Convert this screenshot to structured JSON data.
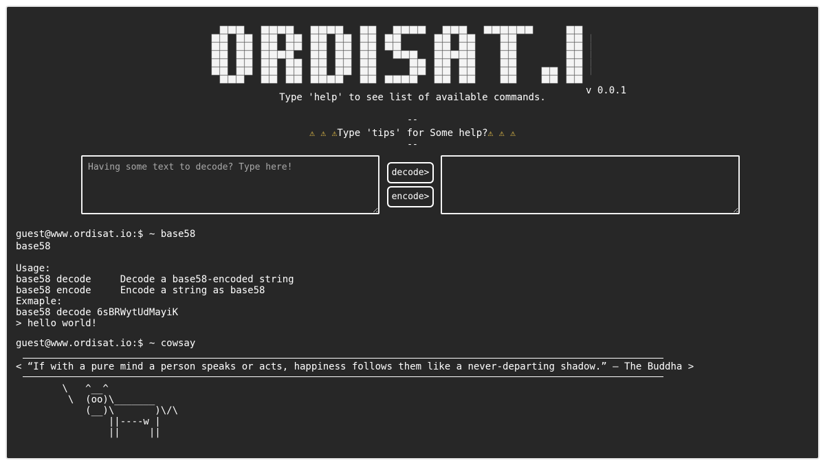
{
  "header": {
    "logo_text": "ORDISAT.IO",
    "version": "v 0.0.1",
    "help_text": "Type 'help' to see list of available commands.",
    "separator": "--",
    "tips_text": "Type 'tips' for Some help?",
    "warning_icon": "⚠"
  },
  "converter": {
    "input_placeholder": "Having some text to decode? Type here!",
    "input_value": "",
    "output_value": "",
    "decode_label": "decode>",
    "encode_label": "encode>"
  },
  "terminal": {
    "prompt1": "guest@www.ordisat.io:$ ~ base58",
    "output1": "base58\n\nUsage:\nbase58 decode     Decode a base58-encoded string\nbase58 encode     Encode a string as base58\nExmaple:\nbase58 decode 6sBRWytUdMayiK\n> hello world!",
    "prompt2": "guest@www.ordisat.io:$ ~ cowsay",
    "quote": "< “If with a pure mind a person speaks or acts, happiness follows them like a never-departing shadow.” — The Buddha >",
    "cow": "        \\   ^__^\n         \\  (oo)\\_______\n            (__)\\       )\\/\\\n                ||----w |\n                ||     ||"
  }
}
